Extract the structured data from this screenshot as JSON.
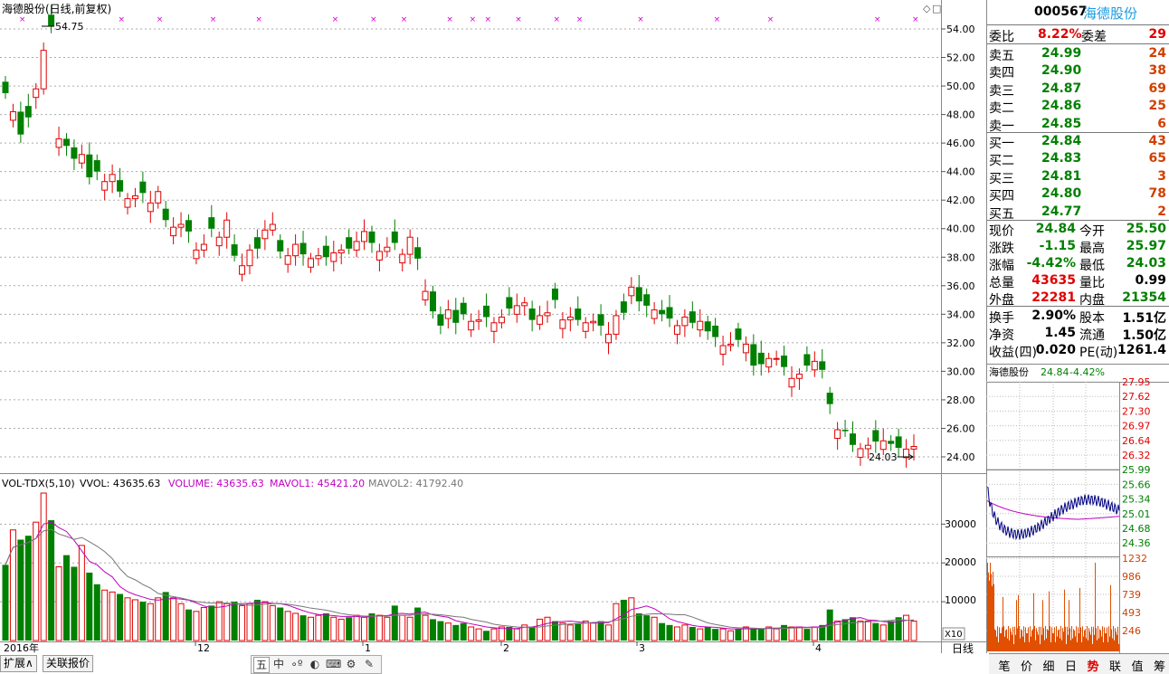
{
  "main_chart": {
    "title": "海德股份(日线,前复权)",
    "high_label": "54.75",
    "low_label": "24.03",
    "price_ticks": [
      "54.00",
      "52.00",
      "50.00",
      "48.00",
      "46.00",
      "44.00",
      "42.00",
      "40.00",
      "38.00",
      "36.00",
      "34.00",
      "32.00",
      "30.00",
      "28.00",
      "26.00",
      "24.00"
    ]
  },
  "volume_chart": {
    "title": "VOL-TDX(5,10)",
    "vvol_label": "VVOL: 43635.63",
    "volume_label": "VOLUME: 43635.63",
    "mavol1_label": "MAVOL1: 45421.20",
    "mavol2_label": "MAVOL2: 41792.40",
    "ticks": [
      "30000",
      "20000",
      "10000"
    ],
    "x10_label": "X10"
  },
  "date_axis": {
    "labels": [
      "2016年",
      "12",
      "1",
      "2",
      "3",
      "4"
    ],
    "period": "日线"
  },
  "quote": {
    "code": "000567",
    "name": "海德股份",
    "weibi_label": "委比",
    "weibi_value": "8.22%",
    "weicha_label": "委差",
    "weicha_value": "29",
    "sell": [
      {
        "label": "卖五",
        "price": "24.99",
        "vol": "24"
      },
      {
        "label": "卖四",
        "price": "24.90",
        "vol": "38"
      },
      {
        "label": "卖三",
        "price": "24.87",
        "vol": "69"
      },
      {
        "label": "卖二",
        "price": "24.86",
        "vol": "25"
      },
      {
        "label": "卖一",
        "price": "24.85",
        "vol": "6"
      }
    ],
    "buy": [
      {
        "label": "买一",
        "price": "24.84",
        "vol": "43"
      },
      {
        "label": "买二",
        "price": "24.83",
        "vol": "65"
      },
      {
        "label": "买三",
        "price": "24.81",
        "vol": "3"
      },
      {
        "label": "买四",
        "price": "24.80",
        "vol": "78"
      },
      {
        "label": "买五",
        "price": "24.77",
        "vol": "2"
      }
    ],
    "stats": [
      {
        "l1": "现价",
        "v1": "24.84",
        "c1": "grn",
        "l2": "今开",
        "v2": "25.50",
        "c2": "grn"
      },
      {
        "l1": "涨跌",
        "v1": "-1.15",
        "c1": "grn",
        "l2": "最高",
        "v2": "25.97",
        "c2": "grn"
      },
      {
        "l1": "涨幅",
        "v1": "-4.42%",
        "c1": "grn",
        "l2": "最低",
        "v2": "24.03",
        "c2": "grn"
      },
      {
        "l1": "总量",
        "v1": "43635",
        "c1": "red",
        "l2": "量比",
        "v2": "0.99",
        "c2": "blk"
      },
      {
        "l1": "外盘",
        "v1": "22281",
        "c1": "red",
        "l2": "内盘",
        "v2": "21354",
        "c2": "grn"
      }
    ],
    "fin": [
      {
        "l1": "换手",
        "v1": "2.90%",
        "l2": "股本",
        "v2": "1.51亿"
      },
      {
        "l1": "净资",
        "v1": "1.45",
        "l2": "流通",
        "v2": "1.50亿"
      },
      {
        "l1": "收益(四)",
        "v1": "0.020",
        "l2": "PE(动)",
        "v2": "1261.4"
      }
    ]
  },
  "intraday": {
    "name": "海德股份",
    "price": "24.84",
    "change": "-4.42%",
    "price_ticks": [
      "27.95",
      "27.62",
      "27.30",
      "26.97",
      "26.64",
      "26.32",
      "25.99",
      "25.66",
      "25.34",
      "25.01",
      "24.68",
      "24.36"
    ],
    "vol_ticks": [
      "1232",
      "986",
      "739",
      "493",
      "246"
    ]
  },
  "bottom_tabs": [
    "扩展∧",
    "关联报价"
  ],
  "toolbar_icons": [
    "五",
    "中",
    "∘º",
    "⌨",
    "⚙",
    "✎"
  ],
  "mini_tabs": [
    "笔",
    "价",
    "细",
    "日",
    "势",
    "联",
    "值",
    "筹"
  ]
}
